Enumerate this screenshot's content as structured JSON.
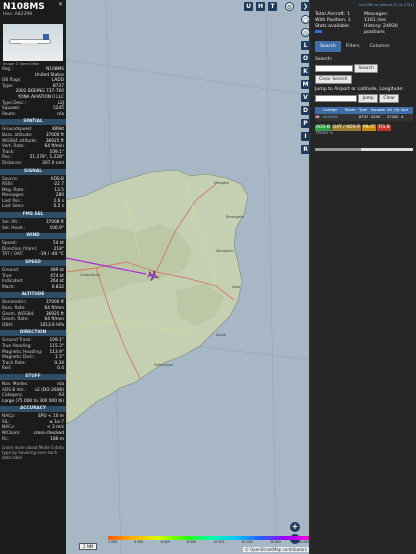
{
  "aircraft": {
    "callsign": "N108MS",
    "hex_line": "Hex: A82398",
    "photo_credit": "Image © Sierra Mike"
  },
  "left_panel": {
    "rows_top": [
      {
        "k": "Reg.:",
        "v": "N108MS"
      },
      {
        "k": "",
        "v": "United States"
      },
      {
        "k": "DB flags:",
        "v": "LADD"
      },
      {
        "k": "Type:",
        "v": "B737"
      },
      {
        "k": "",
        "v": "2002 BOEING 737-700"
      },
      {
        "k": "",
        "v": "YONA AVIATION II LLC"
      },
      {
        "k": "Type Desc.:",
        "v": "L2J"
      },
      {
        "k": "Squawk:",
        "v": "5245"
      },
      {
        "k": "Route:",
        "v": "n/a"
      }
    ],
    "sections": [
      {
        "title": "SPATIAL",
        "rows": [
          {
            "k": "Groundspeed:",
            "v": "489kt"
          },
          {
            "k": "Baro. altitude:",
            "v": "37000 ft"
          },
          {
            "k": "WGS84 altitude:",
            "v": "36925 ft"
          },
          {
            "k": "Vert. Rate:",
            "v": "64 ft/min"
          },
          {
            "k": "Track:",
            "v": "109.1°"
          },
          {
            "k": "Pos.:",
            "v": "51.279°, 1.228°"
          },
          {
            "k": "Distance:",
            "v": "207.0 nmi"
          }
        ]
      },
      {
        "title": "SIGNAL",
        "rows": [
          {
            "k": "Source:",
            "v": "ADS-B"
          },
          {
            "k": "RSSI:",
            "v": "-22.7"
          },
          {
            "k": "Msg. Rate:",
            "v": "13.5"
          },
          {
            "k": "Messages:",
            "v": "280"
          },
          {
            "k": "Last Pos.:",
            "v": "2.6 s"
          },
          {
            "k": "Last Seen:",
            "v": "0.2 s"
          }
        ]
      },
      {
        "title": "FMS SEL",
        "rows": [
          {
            "k": "Sel. Alt.:",
            "v": "37008 ft"
          },
          {
            "k": "Sel. Head.:",
            "v": "106.9°"
          }
        ]
      },
      {
        "title": "WIND",
        "rows": [
          {
            "k": "Speed:",
            "v": "54 kt"
          },
          {
            "k": "Direction (from):",
            "v": "218°"
          },
          {
            "k": "TAT / OAT:",
            "v": "-19 / -49 °C"
          }
        ]
      },
      {
        "title": "SPEED",
        "rows": [
          {
            "k": "Ground:",
            "v": "489 kt"
          },
          {
            "k": "True:",
            "v": "474 kt"
          },
          {
            "k": "Indicated:",
            "v": "264 kt"
          },
          {
            "k": "Mach:",
            "v": "0.832"
          }
        ]
      },
      {
        "title": "ALTITUDE",
        "rows": [
          {
            "k": "Barometric:",
            "v": "37000 ft"
          },
          {
            "k": "Baro. Rate:",
            "v": "64 ft/min"
          },
          {
            "k": "Geom. WGS84:",
            "v": "36925 ft"
          },
          {
            "k": "Geom. Rate:",
            "v": "64 ft/min"
          },
          {
            "k": "QNH:",
            "v": "1013.6 hPa"
          }
        ]
      },
      {
        "title": "DIRECTION",
        "rows": [
          {
            "k": "Ground Track:",
            "v": "109.1°"
          },
          {
            "k": "True Heading:",
            "v": "115.3°"
          },
          {
            "k": "Magnetic Heading:",
            "v": "113.9°"
          },
          {
            "k": "Magnetic Decl.:",
            "v": "1.5°"
          },
          {
            "k": "Track Rate:",
            "v": "0.34"
          },
          {
            "k": "Roll:",
            "v": "0.4"
          }
        ]
      },
      {
        "title": "STUFF",
        "rows": [
          {
            "k": "Nav. Modes:",
            "v": "n/a"
          },
          {
            "k": "ADS-B Ver.:",
            "v": "v2 (DO-260B)"
          },
          {
            "k": "Category:",
            "v": "A3"
          }
        ]
      }
    ],
    "category_desc": "Large (75 000 to 300 000 lb)",
    "accuracy": {
      "title": "ACCURACY",
      "rows": [
        {
          "k": "NACp:",
          "v": "EPU < 10 m"
        },
        {
          "k": "SIL:",
          "v": "≤ 1e-7"
        },
        {
          "k": "NACv:",
          "v": "< 3 m/s"
        },
        {
          "k": "NICbaro:",
          "v": "cross-checked"
        },
        {
          "k": "Rc:",
          "v": "186 m"
        }
      ]
    },
    "footnote": "Learn more about Mode S data type by hovering over each data label"
  },
  "top_buttons": [
    "U",
    "H",
    "T"
  ],
  "rail_buttons": [
    "L",
    "O",
    "K",
    "M",
    "V",
    "D",
    "P",
    "I",
    "R"
  ],
  "map": {
    "scale_label": "2 NM",
    "attribution": "© OpenStreetMap contributors",
    "zoom_in": "+",
    "zoom_out": "−",
    "altitude_ticks": [
      "1 000",
      "4 000",
      "6 000",
      "8 000",
      "10 000",
      "20 000",
      "30 000",
      "40 000+"
    ],
    "place_labels": [
      "Canterbury",
      "Dover",
      "Deal",
      "Sandwich",
      "Ramsgate",
      "Margate",
      "Folkestone"
    ]
  },
  "right_panel": {
    "github_link": "tar1090 on github (3.14.1731)",
    "stats": {
      "total_aircraft_label": "Total Aircraft: 1",
      "messages_label": "Messages:",
      "messages_rate": "1161 /sec",
      "with_position_label": "With Position: 1",
      "history_label": "History: 24930",
      "history_unit": "positions",
      "stats_available": "Stats available"
    },
    "tabs": [
      "Search",
      "Filters",
      "Columns"
    ],
    "search_label": "Search:",
    "search_button": "Search",
    "clear_search_button": "Clear Search",
    "jump_label": "Jump to Airport or Latitude, Longitude:",
    "jump_button": "Jump",
    "clear_button": "Clear",
    "table_headers": [
      "Callsign",
      "Route",
      "Type",
      "Squawk",
      "Alt. (ft)",
      "Spd"
    ],
    "table_rows": [
      {
        "flag": "🇺🇸",
        "callsign": "N108MS",
        "route": "",
        "type": "B737",
        "squawk": "5245",
        "alt": "37000",
        "spd": "4"
      }
    ],
    "legend": [
      {
        "label": "ADS-B",
        "color": "#2f9a45"
      },
      {
        "label": "UAT / ADS-R",
        "color": "#9a7b2f"
      },
      {
        "label": "MLAT",
        "color": "#c08a00"
      },
      {
        "label": "TIS-B",
        "color": "#c0392b"
      }
    ],
    "legend_second": "Mode-S"
  }
}
